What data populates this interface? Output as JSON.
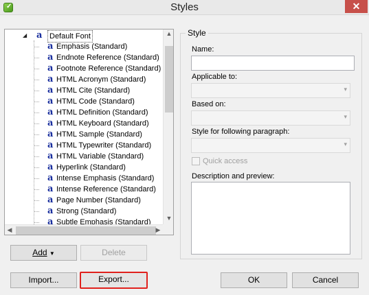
{
  "window": {
    "title": "Styles",
    "close_glyph": "✕"
  },
  "tree": {
    "root": {
      "label": "Default Font",
      "icon": "a"
    },
    "items": [
      "Emphasis (Standard)",
      "Endnote Reference (Standard)",
      "Footnote Reference (Standard)",
      "HTML Acronym (Standard)",
      "HTML Cite (Standard)",
      "HTML Code (Standard)",
      "HTML Definition (Standard)",
      "HTML Keyboard (Standard)",
      "HTML Sample (Standard)",
      "HTML Typewriter (Standard)",
      "HTML Variable (Standard)",
      "Hyperlink (Standard)",
      "Intense Emphasis (Standard)",
      "Intense Reference (Standard)",
      "Page Number (Standard)",
      "Strong (Standard)",
      "Subtle Emphasis (Standard)"
    ],
    "item_icon": "a"
  },
  "buttons": {
    "add": "Add",
    "delete": "Delete",
    "import": "Import...",
    "export": "Export...",
    "ok": "OK",
    "cancel": "Cancel"
  },
  "style_group": {
    "title": "Style",
    "name_label": "Name:",
    "name_value": "",
    "applicable_label": "Applicable to:",
    "based_on_label": "Based on:",
    "following_label": "Style for following paragraph:",
    "quick_access_label": "Quick access",
    "quick_access_checked": false,
    "description_label": "Description and preview:"
  },
  "colors": {
    "close_button": "#c7504a",
    "style_icon": "#1a2f9e",
    "export_highlight": "#e0201c"
  }
}
